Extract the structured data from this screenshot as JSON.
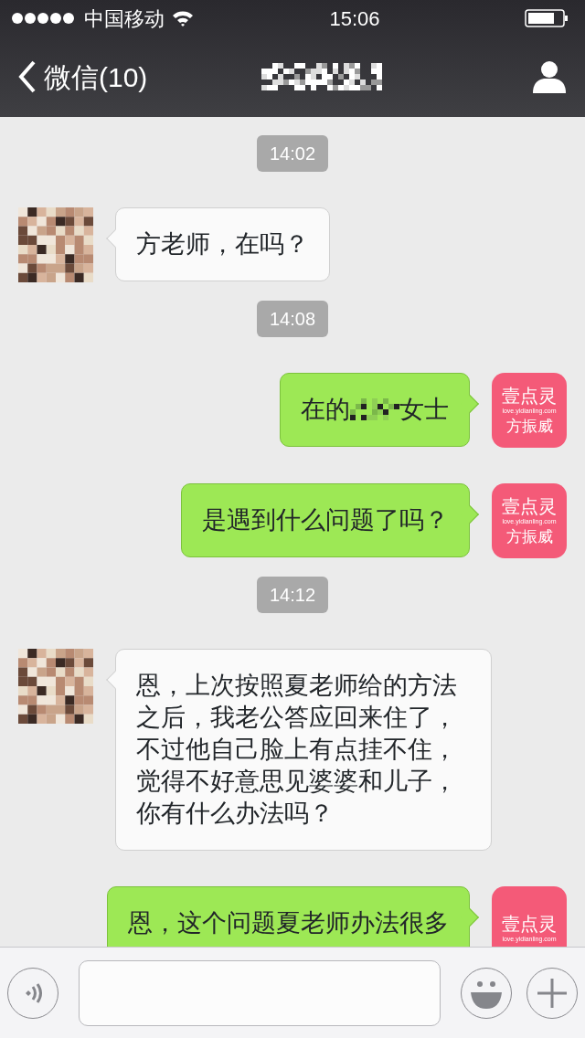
{
  "status_bar": {
    "carrier": "中国移动",
    "time": "15:06"
  },
  "nav": {
    "back_label": "微信(10)"
  },
  "messages": [
    {
      "kind": "time",
      "text": "14:02"
    },
    {
      "kind": "received",
      "text": "方老师，在吗？"
    },
    {
      "kind": "time",
      "text": "14:08"
    },
    {
      "kind": "sent",
      "segments": [
        {
          "kind": "text",
          "text": "在的"
        },
        {
          "kind": "obscured"
        },
        {
          "kind": "text",
          "text": "女士"
        }
      ],
      "avatar": {
        "brand": "壹点灵",
        "site": "love.yidianling.com",
        "name": "方振威"
      }
    },
    {
      "kind": "sent",
      "text": "是遇到什么问题了吗？",
      "avatar": {
        "brand": "壹点灵",
        "site": "love.yidianling.com",
        "name": "方振威"
      }
    },
    {
      "kind": "time",
      "text": "14:12"
    },
    {
      "kind": "received",
      "text": "恩，上次按照夏老师给的方法之后，我老公答应回来住了，不过他自己脸上有点挂不住，觉得不好意思见婆婆和儿子，你有什么办法吗？"
    },
    {
      "kind": "sent",
      "text": "恩，这个问题夏老师办法很多",
      "avatar": {
        "brand": "壹点灵",
        "site": "love.yidianling.com"
      }
    }
  ]
}
